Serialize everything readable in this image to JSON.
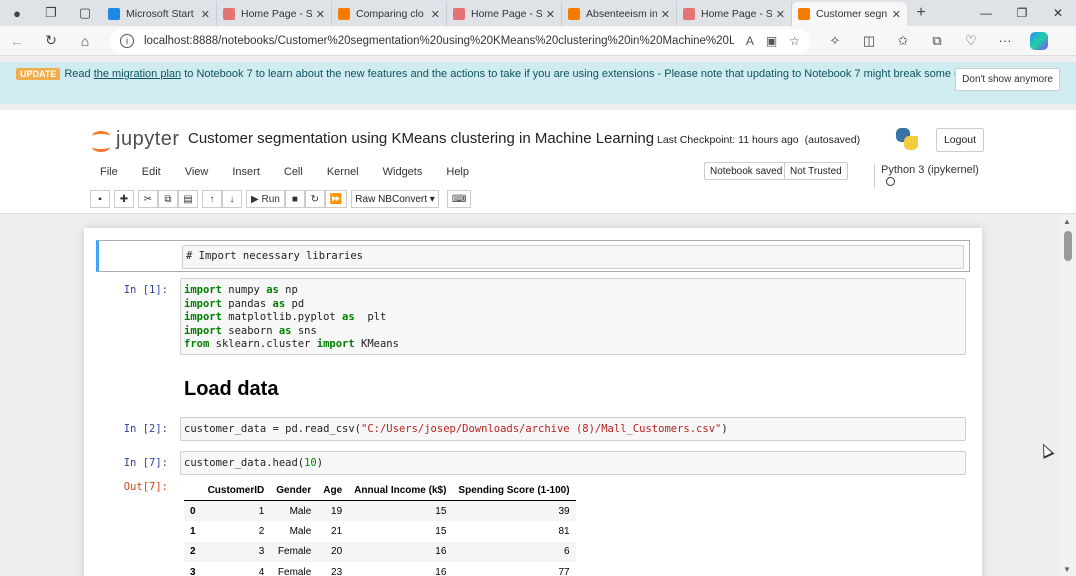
{
  "browser": {
    "tabs": [
      {
        "title": "Microsoft Start",
        "color": "#1e88e5"
      },
      {
        "title": "Home Page - S",
        "color": "#e57373"
      },
      {
        "title": "Comparing clo",
        "color": "#f57c00"
      },
      {
        "title": "Home Page - S",
        "color": "#e57373"
      },
      {
        "title": "Absenteeism in",
        "color": "#f57c00"
      },
      {
        "title": "Home Page - S",
        "color": "#e57373"
      },
      {
        "title": "Customer segn",
        "color": "#f57c00"
      }
    ],
    "close_glyph": "✕",
    "new_tab_glyph": "+",
    "url": "localhost:8888/notebooks/Customer%20segmentation%20using%20KMeans%20clustering%20in%20Machine%20Le...",
    "icons": [
      "back-icon",
      "refresh-icon",
      "home-icon",
      "info-icon",
      "read-aloud-icon",
      "immersive-reader-icon",
      "favorite-icon",
      "extensions-icon",
      "split-screen-icon",
      "favorites-icon",
      "collections-icon",
      "browser-essentials-icon",
      "more-icon",
      "copilot-icon"
    ]
  },
  "banner": {
    "badge": "UPDATE",
    "text_before": "Read ",
    "link": "the migration plan",
    "text_after": " to Notebook 7 to learn about the new features and the actions to take if you are using extensions - Please note that updating to Notebook 7 might break some of your extensions.",
    "dismiss": "Don't show anymore"
  },
  "jupyter": {
    "logo_text": "jupyter",
    "title": "Customer segmentation using KMeans clustering in Machine Learning",
    "checkpoint": "Last Checkpoint: 11 hours ago",
    "autosave": "(autosaved)",
    "logout": "Logout",
    "menu": [
      "File",
      "Edit",
      "View",
      "Insert",
      "Cell",
      "Kernel",
      "Widgets",
      "Help"
    ],
    "notebook_saved": "Notebook saved",
    "not_trusted": "Not Trusted",
    "kernel_name": "Python 3 (ipykernel)",
    "toolbar": {
      "run_label": "Run",
      "cell_type": "Raw NBConvert"
    }
  },
  "cells": {
    "raw_cell": "# Import necessary libraries",
    "in1": "In [1]:",
    "in2": "In [2]:",
    "in7": "In [7]:",
    "out7": "Out[7]:",
    "heading": "Load data",
    "code2_var": "customer_data = pd.read_csv(",
    "code2_str": "\"C:/Users/josep/Downloads/archive (8)/Mall_Customers.csv\"",
    "code2_end": ")",
    "code7_a": "customer_data.head(",
    "code7_num": "10",
    "code7_b": ")"
  },
  "dataframe": {
    "columns": [
      "",
      "CustomerID",
      "Gender",
      "Age",
      "Annual Income (k$)",
      "Spending Score (1-100)"
    ],
    "rows": [
      [
        "0",
        "1",
        "Male",
        "19",
        "15",
        "39"
      ],
      [
        "1",
        "2",
        "Male",
        "21",
        "15",
        "81"
      ],
      [
        "2",
        "3",
        "Female",
        "20",
        "16",
        "6"
      ],
      [
        "3",
        "4",
        "Female",
        "23",
        "16",
        "77"
      ]
    ]
  }
}
